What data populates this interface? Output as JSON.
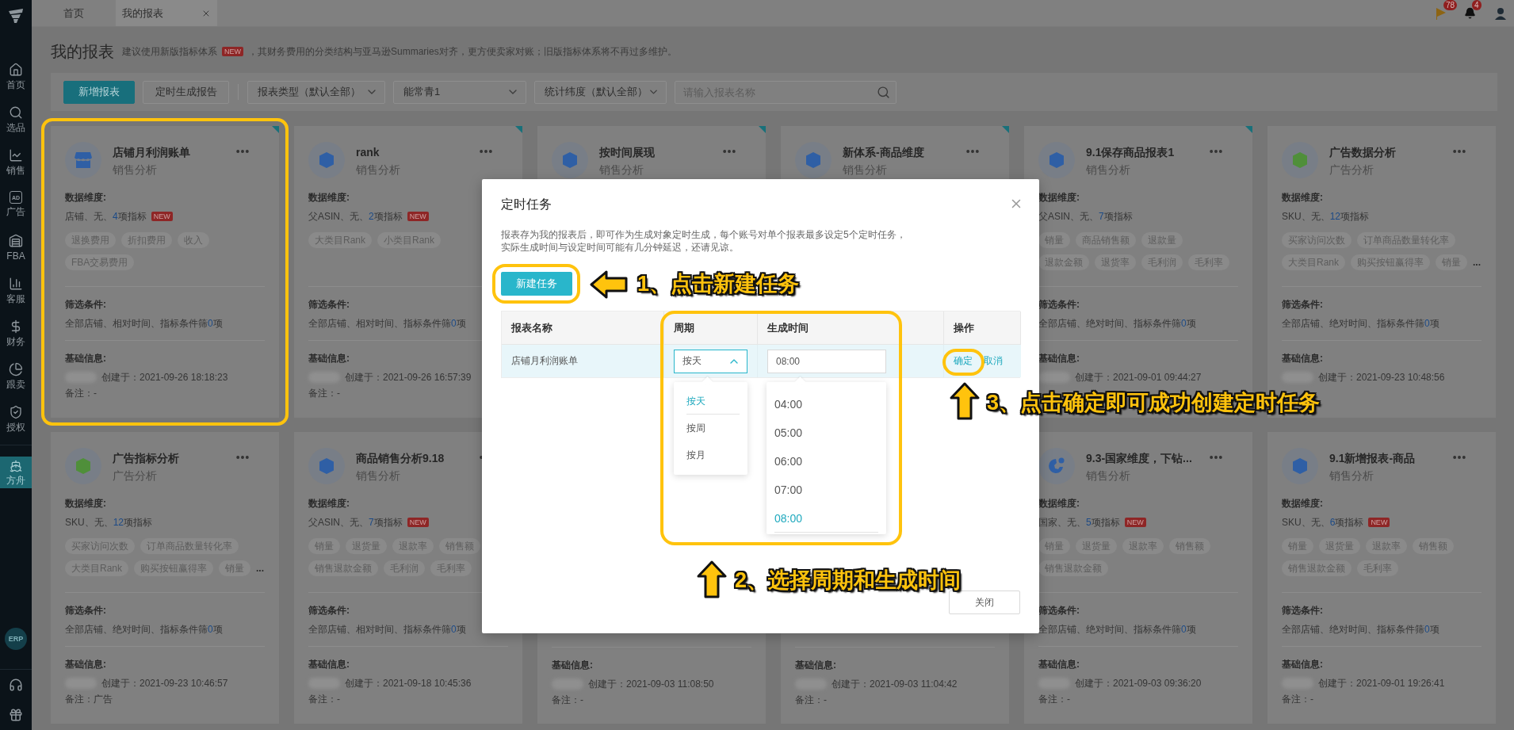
{
  "sidebar": {
    "items": [
      {
        "kind": "home",
        "label": "首页",
        "selected": false
      },
      {
        "kind": "search",
        "label": "选品",
        "selected": false
      },
      {
        "kind": "sales",
        "label": "销售",
        "selected": false
      },
      {
        "kind": "ad",
        "label": "广告",
        "icon_text": "AD",
        "selected": false
      },
      {
        "kind": "fba",
        "label": "FBA",
        "selected": false
      },
      {
        "kind": "service",
        "label": "客服",
        "selected": false
      },
      {
        "kind": "finance",
        "label": "财务",
        "selected": false
      },
      {
        "kind": "follow",
        "label": "跟卖",
        "selected": false
      },
      {
        "kind": "auth",
        "label": "授权",
        "selected": false
      },
      {
        "kind": "ark",
        "label": "方舟",
        "selected": true
      }
    ],
    "erp": "ERP"
  },
  "tabs": [
    {
      "label": "首页",
      "selected": false,
      "closable": false
    },
    {
      "label": "我的报表",
      "selected": true,
      "closable": true
    }
  ],
  "header_badges": [
    {
      "kind": "flag",
      "count": "78"
    },
    {
      "kind": "bell",
      "count": "4"
    }
  ],
  "page": {
    "title": "我的报表",
    "notice_before": "建议使用新版指标体系",
    "notice_badge": "NEW",
    "notice_after": "，其财务费用的分类结构与亚马逊Summaries对齐，更方便卖家对账；旧版指标体系将不再过多维护。"
  },
  "toolbar": {
    "buttons": [
      {
        "label": "新增报表",
        "kind": "primary"
      },
      {
        "label": "定时生成报告",
        "kind": "default"
      }
    ],
    "selects": [
      "报表类型（默认全部）",
      "能常青1",
      "统计纬度（默认全部）"
    ],
    "search": {
      "placeholder": "请输入报表名称"
    }
  },
  "cards": [
    {
      "kind": "store",
      "color": "#2f5fa5",
      "title": "店铺月利润账单",
      "subtitle": "销售分析",
      "corner": true,
      "dim_label": "数据维度:",
      "dims": {
        "prefix": "店铺、无、",
        "count": "4",
        "suffix": "项指标",
        "badge": "NEW"
      },
      "tag_rows": [
        [
          "退换费用",
          "折扣费用",
          "收入"
        ],
        [
          "FBA交易费用"
        ]
      ],
      "filter_label": "筛选条件:",
      "filter": {
        "prefix": "全部店铺、相对时间、指标条件筛",
        "count": "0",
        "suffix": "项"
      },
      "info_label": "基础信息:",
      "created": "创建于：2021-09-26 18:18:23",
      "remark": "备注：-"
    },
    {
      "kind": "cube",
      "color": "#2f5fa5",
      "title": "rank",
      "subtitle": "销售分析",
      "corner": true,
      "dim_label": "数据维度:",
      "dims": {
        "prefix": "父ASIN、无、",
        "count": "2",
        "suffix": "项指标",
        "badge": "NEW"
      },
      "tag_rows": [
        [
          "大类目Rank",
          "小类目Rank"
        ]
      ],
      "filter_label": "筛选条件:",
      "filter": {
        "prefix": "全部店铺、相对时间、指标条件筛",
        "count": "0",
        "suffix": "项"
      },
      "info_label": "基础信息:",
      "created": "创建于：2021-09-26 16:57:39",
      "remark": "备注：-"
    },
    {
      "kind": "cube",
      "color": "#2f5fa5",
      "title": "按时间展现",
      "subtitle": "销售分析",
      "corner": true
    },
    {
      "kind": "cube",
      "color": "#2f5fa5",
      "title": "新体系-商品维度",
      "subtitle": "销售分析",
      "corner": true
    },
    {
      "kind": "cube",
      "color": "#2f5fa5",
      "title": "9.1保存商品报表1",
      "subtitle": "销售分析",
      "corner": true,
      "dim_label": "数据维度:",
      "dims": {
        "prefix": "父ASIN、无、",
        "count": "7",
        "suffix": "项指标"
      },
      "tag_rows": [
        [
          "销量",
          "商品销售额",
          "退款量"
        ],
        [
          "退款金额",
          "退货率",
          "毛利润",
          "毛利率"
        ]
      ],
      "filter_label": "筛选条件:",
      "filter": {
        "prefix": "全部店铺、绝对时间、指标条件筛",
        "count": "0",
        "suffix": "项"
      },
      "info_label": "基础信息:",
      "created": "创建于：2021-09-01 09:44:27"
    },
    {
      "kind": "cube",
      "color": "#4f8f3a",
      "title": "广告数据分析",
      "subtitle": "广告分析",
      "dim_label": "数据维度:",
      "dims": {
        "prefix": "SKU、无、",
        "count": "12",
        "suffix": "项指标"
      },
      "tag_rows": [
        [
          "买家访问次数",
          "订单商品数量转化率"
        ],
        [
          "大类目Rank",
          "购买按钮赢得率",
          "销量"
        ]
      ],
      "tags_overflow": "...",
      "filter_label": "筛选条件:",
      "filter": {
        "prefix": "全部店铺、绝对时间、指标条件筛",
        "count": "0",
        "suffix": "项"
      },
      "info_label": "基础信息:",
      "created": "创建于：2021-09-23 10:48:56"
    },
    {
      "kind": "cube",
      "color": "#4f8f3a",
      "title": "广告指标分析",
      "subtitle": "广告分析",
      "dim_label": "数据维度:",
      "dims": {
        "prefix": "SKU、无、",
        "count": "12",
        "suffix": "项指标"
      },
      "tag_rows": [
        [
          "买家访问次数",
          "订单商品数量转化率"
        ],
        [
          "大类目Rank",
          "购买按钮赢得率",
          "销量"
        ]
      ],
      "tags_overflow": "...",
      "filter_label": "筛选条件:",
      "filter": {
        "prefix": "全部店铺、绝对时间、指标条件筛",
        "count": "0",
        "suffix": "项"
      },
      "info_label": "基础信息:",
      "created": "创建于：2021-09-23 10:46:57",
      "remark": "备注：广告"
    },
    {
      "kind": "cube",
      "color": "#2f5fa5",
      "title": "商品销售分析9.18",
      "subtitle": "销售分析",
      "dim_label": "数据维度:",
      "dims": {
        "prefix": "父ASIN、无、",
        "count": "7",
        "suffix": "项指标",
        "badge": "NEW"
      },
      "tag_rows": [
        [
          "销量",
          "退货量",
          "退款率",
          "销售额"
        ],
        [
          "销售退款金额",
          "毛利润",
          "毛利率"
        ]
      ],
      "filter_label": "筛选条件:",
      "filter": {
        "prefix": "全部店铺、相对时间、指标条件筛",
        "count": "0",
        "suffix": "项"
      },
      "info_label": "基础信息:",
      "created": "创建于：2021-09-18 10:45:36",
      "remark": "备注：-"
    },
    {
      "info_label": "基础信息:",
      "created": "创建于：2021-09-03 11:08:50",
      "remark": "备注：-"
    },
    {
      "info_label": "基础信息:",
      "created": "创建于：2021-09-03 11:04:42",
      "remark": "备注：-"
    },
    {
      "kind": "globe",
      "color": "#2f5fa5",
      "title": "9.3-国家维度，下钻...",
      "subtitle": "销售分析",
      "dim_label": "数据维度:",
      "dims": {
        "prefix": "国家、无、",
        "count": "5",
        "suffix": "项指标",
        "badge": "NEW"
      },
      "tag_rows": [
        [
          "销量",
          "退货量",
          "退款率",
          "销售额"
        ],
        [
          "销售退款金额"
        ]
      ],
      "filter_label": "筛选条件:",
      "filter": {
        "prefix": "全部店铺、绝对时间、指标条件筛",
        "count": "0",
        "suffix": "项"
      },
      "info_label": "基础信息:",
      "created": "创建于：2021-09-03 09:36:20",
      "remark": "备注：-"
    },
    {
      "kind": "cube",
      "color": "#2f5fa5",
      "title": "9.1新增报表-商品",
      "subtitle": "销售分析",
      "dim_label": "数据维度:",
      "dims": {
        "prefix": "SKU、无、",
        "count": "6",
        "suffix": "项指标",
        "badge": "NEW"
      },
      "tag_rows": [
        [
          "销量",
          "退货量",
          "退款率",
          "销售额"
        ],
        [
          "销售退款金额",
          "毛利率"
        ]
      ],
      "filter_label": "筛选条件:",
      "filter": {
        "prefix": "全部店铺、绝对时间、指标条件筛",
        "count": "0",
        "suffix": "项"
      },
      "info_label": "基础信息:",
      "created": "创建于：2021-09-01 19:26:41",
      "remark": "备注：-"
    }
  ],
  "modal": {
    "title": "定时任务",
    "description": [
      "报表存为我的报表后，即可作为生成对象定时生成，每个账号对单个报表最多设定5个定时任务，",
      "实际生成时间与设定时间可能有几分钟延迟，还请见谅。"
    ],
    "new_button": "新建任务",
    "table": {
      "columns": [
        "报表名称",
        "周期",
        "生成时间",
        "操作"
      ],
      "row": {
        "name": "店铺月利润账单",
        "period": "按天",
        "period_expanded": true,
        "time": "08:00",
        "actions": [
          "确定",
          "取消"
        ]
      }
    },
    "period_options": [
      {
        "label": "按天",
        "selected": true
      },
      {
        "label": "按周",
        "selected": false
      },
      {
        "label": "按月",
        "selected": false
      }
    ],
    "time_options": [
      {
        "label": "04:00",
        "selected": false
      },
      {
        "label": "05:00",
        "selected": false
      },
      {
        "label": "06:00",
        "selected": false
      },
      {
        "label": "07:00",
        "selected": false
      },
      {
        "label": "08:00",
        "selected": true
      }
    ],
    "close_button": "关闭"
  },
  "annotations": [
    {
      "kind": "left",
      "text": "1、点击新建任务"
    },
    {
      "kind": "up",
      "text": "2、选择周期和生成时间"
    },
    {
      "kind": "up",
      "text": "3、点击确定即可成功创建定时任务"
    }
  ]
}
